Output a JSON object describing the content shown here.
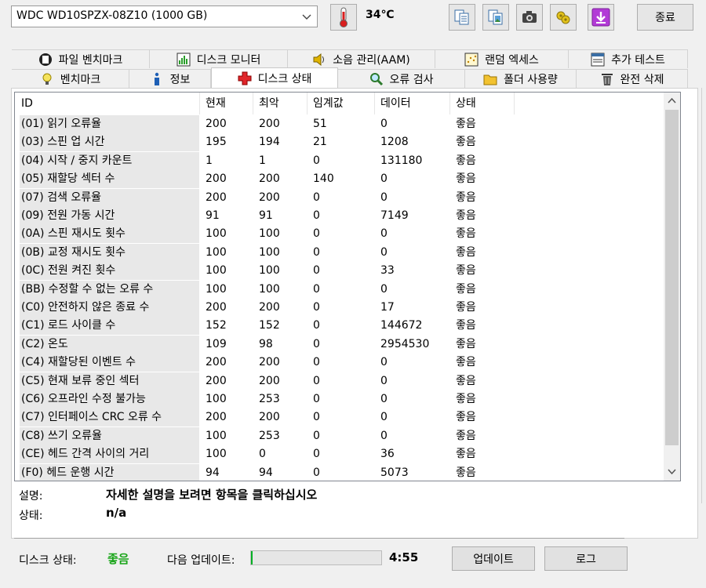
{
  "drive": {
    "selected": "WDC WD10SPZX-08Z10 (1000 GB)"
  },
  "temperature": "34℃",
  "toolbar": {
    "tools": [
      {
        "name": "copy-text-icon"
      },
      {
        "name": "copy-image-icon"
      },
      {
        "name": "screenshot-icon"
      },
      {
        "name": "options-icon"
      },
      {
        "name": "save-icon"
      }
    ],
    "exit_label": "종료"
  },
  "tabs_row1": [
    {
      "label": "파일 벤치마크",
      "icon": "file-benchmark-icon"
    },
    {
      "label": "디스크 모니터",
      "icon": "disk-monitor-icon"
    },
    {
      "label": "소음 관리(AAM)",
      "icon": "speaker-icon"
    },
    {
      "label": "랜덤 엑세스",
      "icon": "random-access-icon"
    },
    {
      "label": "추가 테스트",
      "icon": "extra-tests-icon"
    }
  ],
  "tabs_row2": [
    {
      "label": "벤치마크",
      "icon": "benchmark-icon"
    },
    {
      "label": "정보",
      "icon": "info-icon"
    },
    {
      "label": "디스크 상태",
      "icon": "health-cross-icon",
      "active": true
    },
    {
      "label": "오류 검사",
      "icon": "magnifier-icon"
    },
    {
      "label": "폴더 사용량",
      "icon": "folder-icon"
    },
    {
      "label": "완전 삭제",
      "icon": "trash-icon"
    }
  ],
  "smart": {
    "headers": {
      "id": "ID",
      "current": "현재",
      "worst": "최악",
      "threshold": "임계값",
      "data": "데이터",
      "status": "상태"
    },
    "rows": [
      {
        "id": "(01) 읽기 오류율",
        "current": "200",
        "worst": "200",
        "threshold": "51",
        "data": "0",
        "status": "좋음"
      },
      {
        "id": "(03) 스핀 업 시간",
        "current": "195",
        "worst": "194",
        "threshold": "21",
        "data": "1208",
        "status": "좋음"
      },
      {
        "id": "(04) 시작 / 중지 카운트",
        "current": "1",
        "worst": "1",
        "threshold": "0",
        "data": "131180",
        "status": "좋음"
      },
      {
        "id": "(05) 재할당 섹터 수",
        "current": "200",
        "worst": "200",
        "threshold": "140",
        "data": "0",
        "status": "좋음"
      },
      {
        "id": "(07) 검색 오류율",
        "current": "200",
        "worst": "200",
        "threshold": "0",
        "data": "0",
        "status": "좋음"
      },
      {
        "id": "(09) 전원 가동 시간",
        "current": "91",
        "worst": "91",
        "threshold": "0",
        "data": "7149",
        "status": "좋음"
      },
      {
        "id": "(0A) 스핀 재시도 횟수",
        "current": "100",
        "worst": "100",
        "threshold": "0",
        "data": "0",
        "status": "좋음"
      },
      {
        "id": "(0B) 교정 재시도 횟수",
        "current": "100",
        "worst": "100",
        "threshold": "0",
        "data": "0",
        "status": "좋음"
      },
      {
        "id": "(0C) 전원 켜진 횟수",
        "current": "100",
        "worst": "100",
        "threshold": "0",
        "data": "33",
        "status": "좋음"
      },
      {
        "id": "(BB) 수정할 수 없는 오류 수",
        "current": "100",
        "worst": "100",
        "threshold": "0",
        "data": "0",
        "status": "좋음"
      },
      {
        "id": "(C0) 안전하지 않은 종료 수",
        "current": "200",
        "worst": "200",
        "threshold": "0",
        "data": "17",
        "status": "좋음"
      },
      {
        "id": "(C1) 로드 사이클 수",
        "current": "152",
        "worst": "152",
        "threshold": "0",
        "data": "144672",
        "status": "좋음"
      },
      {
        "id": "(C2) 온도",
        "current": "109",
        "worst": "98",
        "threshold": "0",
        "data": "2954530",
        "status": "좋음"
      },
      {
        "id": "(C4) 재할당된 이벤트 수",
        "current": "200",
        "worst": "200",
        "threshold": "0",
        "data": "0",
        "status": "좋음"
      },
      {
        "id": "(C5) 현재 보류 중인 섹터",
        "current": "200",
        "worst": "200",
        "threshold": "0",
        "data": "0",
        "status": "좋음"
      },
      {
        "id": "(C6) 오프라인 수정 불가능",
        "current": "100",
        "worst": "253",
        "threshold": "0",
        "data": "0",
        "status": "좋음"
      },
      {
        "id": "(C7) 인터페이스 CRC 오류 수",
        "current": "200",
        "worst": "200",
        "threshold": "0",
        "data": "0",
        "status": "좋음"
      },
      {
        "id": "(C8) 쓰기 오류율",
        "current": "100",
        "worst": "253",
        "threshold": "0",
        "data": "0",
        "status": "좋음"
      },
      {
        "id": "(CE) 헤드 간격 사이의 거리",
        "current": "100",
        "worst": "0",
        "threshold": "0",
        "data": "36",
        "status": "좋음"
      },
      {
        "id": "(F0) 헤드 운행 시간",
        "current": "94",
        "worst": "94",
        "threshold": "0",
        "data": "5073",
        "status": "좋음"
      }
    ]
  },
  "details": {
    "desc_label": "설명:",
    "desc_value": "자세한 설명을 보려면 항목을 클릭하십시오",
    "status_label": "상태:",
    "status_value": "n/a"
  },
  "footer": {
    "disk_status_label": "디스크 상태:",
    "disk_status_value": "좋음",
    "next_update_label": "다음 업데이트:",
    "progress_fraction": 0.01,
    "countdown": "4:55",
    "update_button": "업데이트",
    "log_button": "로그"
  },
  "colors": {
    "good_status": "#19a519",
    "progress": "#06b025"
  }
}
